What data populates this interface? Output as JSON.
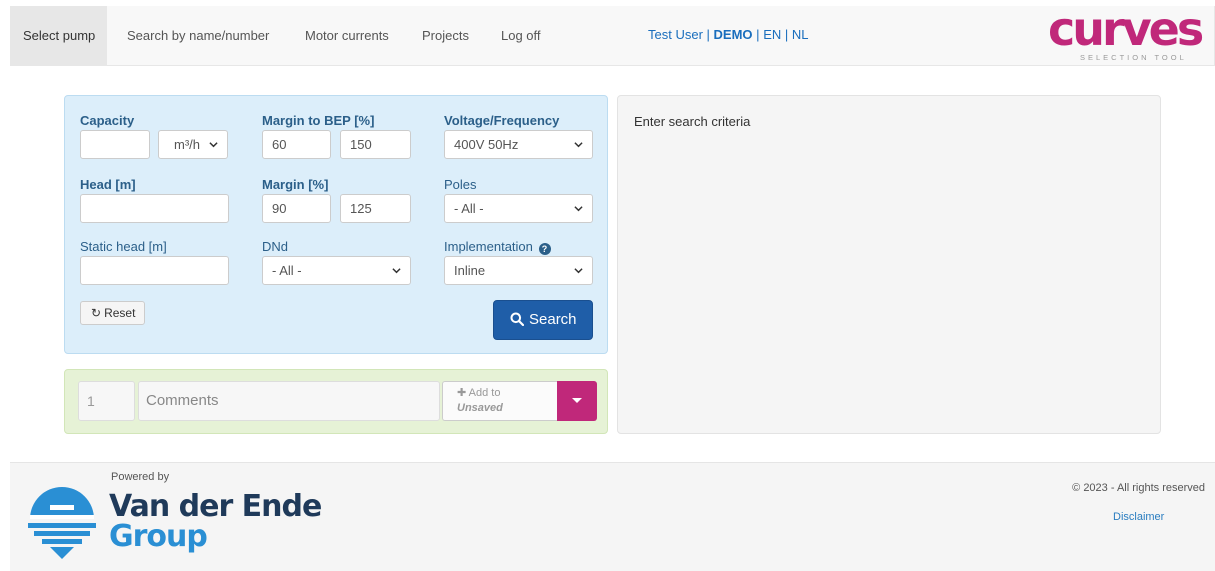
{
  "nav": {
    "items": [
      {
        "label": "Select pump"
      },
      {
        "label": "Search by name/number"
      },
      {
        "label": "Motor currents"
      },
      {
        "label": "Projects"
      },
      {
        "label": "Log off"
      }
    ],
    "user": "Test User",
    "sep": "|",
    "mode": "DEMO",
    "lang_en": "EN",
    "lang_nl": "NL"
  },
  "logo": {
    "text": "curves",
    "subtitle": "SELECTION TOOL",
    "color": "#c0287a"
  },
  "form": {
    "capacity": {
      "label": "Capacity",
      "value": "",
      "unit": "m³/h"
    },
    "margin_bep": {
      "label": "Margin to BEP [%]",
      "min": "60",
      "max": "150"
    },
    "voltage": {
      "label": "Voltage/Frequency",
      "value": "400V 50Hz"
    },
    "head": {
      "label": "Head [m]",
      "value": ""
    },
    "margin": {
      "label": "Margin [%]",
      "min": "90",
      "max": "125"
    },
    "poles": {
      "label": "Poles",
      "value": "- All -"
    },
    "static_head": {
      "label": "Static head [m]",
      "value": ""
    },
    "dnd": {
      "label": "DNd",
      "value": "- All -"
    },
    "implementation": {
      "label": "Implementation",
      "value": "Inline",
      "help_icon": "question-circle-icon"
    },
    "reset_label": "Reset",
    "search_label": "Search"
  },
  "project": {
    "quantity_placeholder": "1",
    "comments_placeholder": "Comments",
    "add_label": "Add to",
    "add_target": "Unsaved"
  },
  "results": {
    "message": "Enter search criteria"
  },
  "footer": {
    "powered_by": "Powered by",
    "company_line1": "Van der Ende",
    "company_line2": "Group",
    "copyright": "© 2023 - All rights reserved",
    "disclaimer": "Disclaimer"
  },
  "colors": {
    "accent": "#1f5ea8",
    "brand": "#c0287a",
    "panel_blue": "#dceefa",
    "panel_green": "#e6f2d6"
  }
}
